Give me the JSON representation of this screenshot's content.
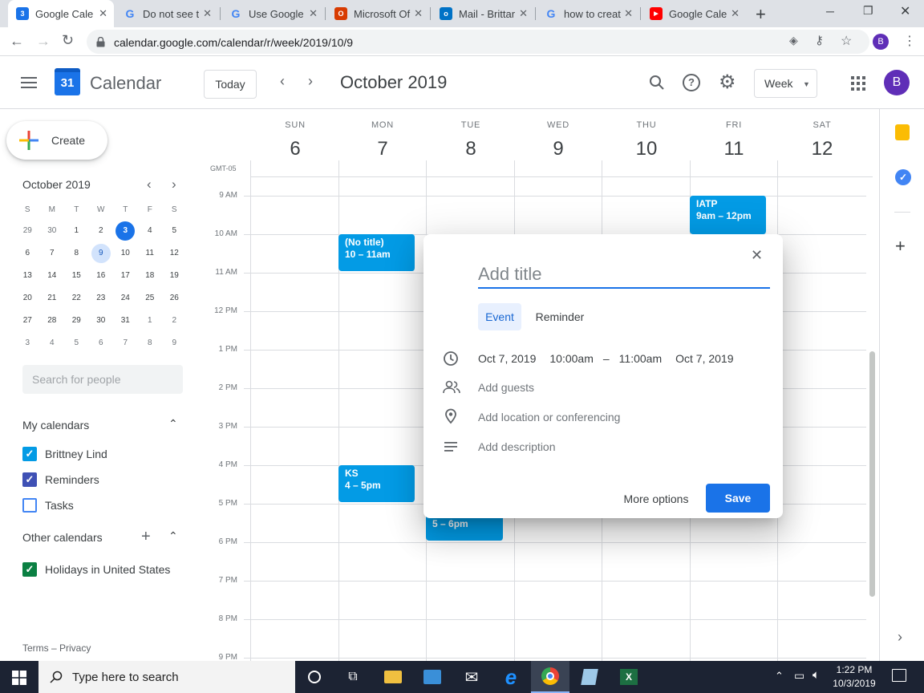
{
  "browser": {
    "tabs": [
      {
        "title": "Google Cale",
        "fav": "3",
        "favcolor": "#1a73e8"
      },
      {
        "title": "Do not see t",
        "fav": "G",
        "favcolor": "#4285f4"
      },
      {
        "title": "Use Google",
        "fav": "G",
        "favcolor": "#4285f4"
      },
      {
        "title": "Microsoft Of",
        "fav": "O",
        "favcolor": "#d83b01"
      },
      {
        "title": "Mail - Brittar",
        "fav": "o",
        "favcolor": "#0072c6"
      },
      {
        "title": "how to creat",
        "fav": "G",
        "favcolor": "#4285f4"
      },
      {
        "title": "Google Cale",
        "fav": "▶",
        "favcolor": "#ff0000"
      }
    ],
    "url": "calendar.google.com/calendar/r/week/2019/10/9",
    "profile_initial": "B"
  },
  "header": {
    "logo_day": "31",
    "app_title": "Calendar",
    "today_label": "Today",
    "period": "October 2019",
    "view_label": "Week",
    "avatar_initial": "B"
  },
  "sidebar": {
    "create_label": "Create",
    "mini_title": "October 2019",
    "weekday_heads": [
      "S",
      "M",
      "T",
      "W",
      "T",
      "F",
      "S"
    ],
    "weeks": [
      [
        "29",
        "30",
        "1",
        "2",
        "3",
        "4",
        "5"
      ],
      [
        "6",
        "7",
        "8",
        "9",
        "10",
        "11",
        "12"
      ],
      [
        "13",
        "14",
        "15",
        "16",
        "17",
        "18",
        "19"
      ],
      [
        "20",
        "21",
        "22",
        "23",
        "24",
        "25",
        "26"
      ],
      [
        "27",
        "28",
        "29",
        "30",
        "31",
        "1",
        "2"
      ],
      [
        "3",
        "4",
        "5",
        "6",
        "7",
        "8",
        "9"
      ]
    ],
    "search_placeholder": "Search for people",
    "my_calendars_title": "My calendars",
    "my_calendars": [
      {
        "label": "Brittney Lind",
        "checked": true,
        "color": "#039be5"
      },
      {
        "label": "Reminders",
        "checked": true,
        "color": "#3f51b5"
      },
      {
        "label": "Tasks",
        "checked": false,
        "color": "#4285f4"
      }
    ],
    "other_calendars_title": "Other calendars",
    "other_calendars": [
      {
        "label": "Holidays in United States",
        "checked": true,
        "color": "#0b8043"
      }
    ],
    "footer": "Terms – Privacy"
  },
  "grid": {
    "timezone": "GMT-05",
    "days": [
      {
        "name": "SUN",
        "date": "6"
      },
      {
        "name": "MON",
        "date": "7"
      },
      {
        "name": "TUE",
        "date": "8"
      },
      {
        "name": "WED",
        "date": "9"
      },
      {
        "name": "THU",
        "date": "10"
      },
      {
        "name": "FRI",
        "date": "11"
      },
      {
        "name": "SAT",
        "date": "12"
      }
    ],
    "hours": [
      "9 AM",
      "10 AM",
      "11 AM",
      "12 PM",
      "1 PM",
      "2 PM",
      "3 PM",
      "4 PM",
      "5 PM",
      "6 PM",
      "7 PM",
      "8 PM",
      "9 PM"
    ],
    "events": [
      {
        "title": "(No title)",
        "time": "10 – 11am"
      },
      {
        "title": "IATP",
        "time": "9am – 12pm"
      },
      {
        "title": "KS",
        "time": "4 – 5pm"
      },
      {
        "title": "",
        "time": "5 – 6pm"
      }
    ]
  },
  "dialog": {
    "title_placeholder": "Add title",
    "tab_event": "Event",
    "tab_reminder": "Reminder",
    "start_date": "Oct 7, 2019",
    "start_time": "10:00am",
    "dash": "–",
    "end_time": "11:00am",
    "end_date": "Oct 7, 2019",
    "guests": "Add guests",
    "location": "Add location or conferencing",
    "description": "Add description",
    "more_options": "More options",
    "save": "Save"
  },
  "taskbar": {
    "search_placeholder": "Type here to search",
    "time": "1:22 PM",
    "date": "10/3/2019"
  }
}
